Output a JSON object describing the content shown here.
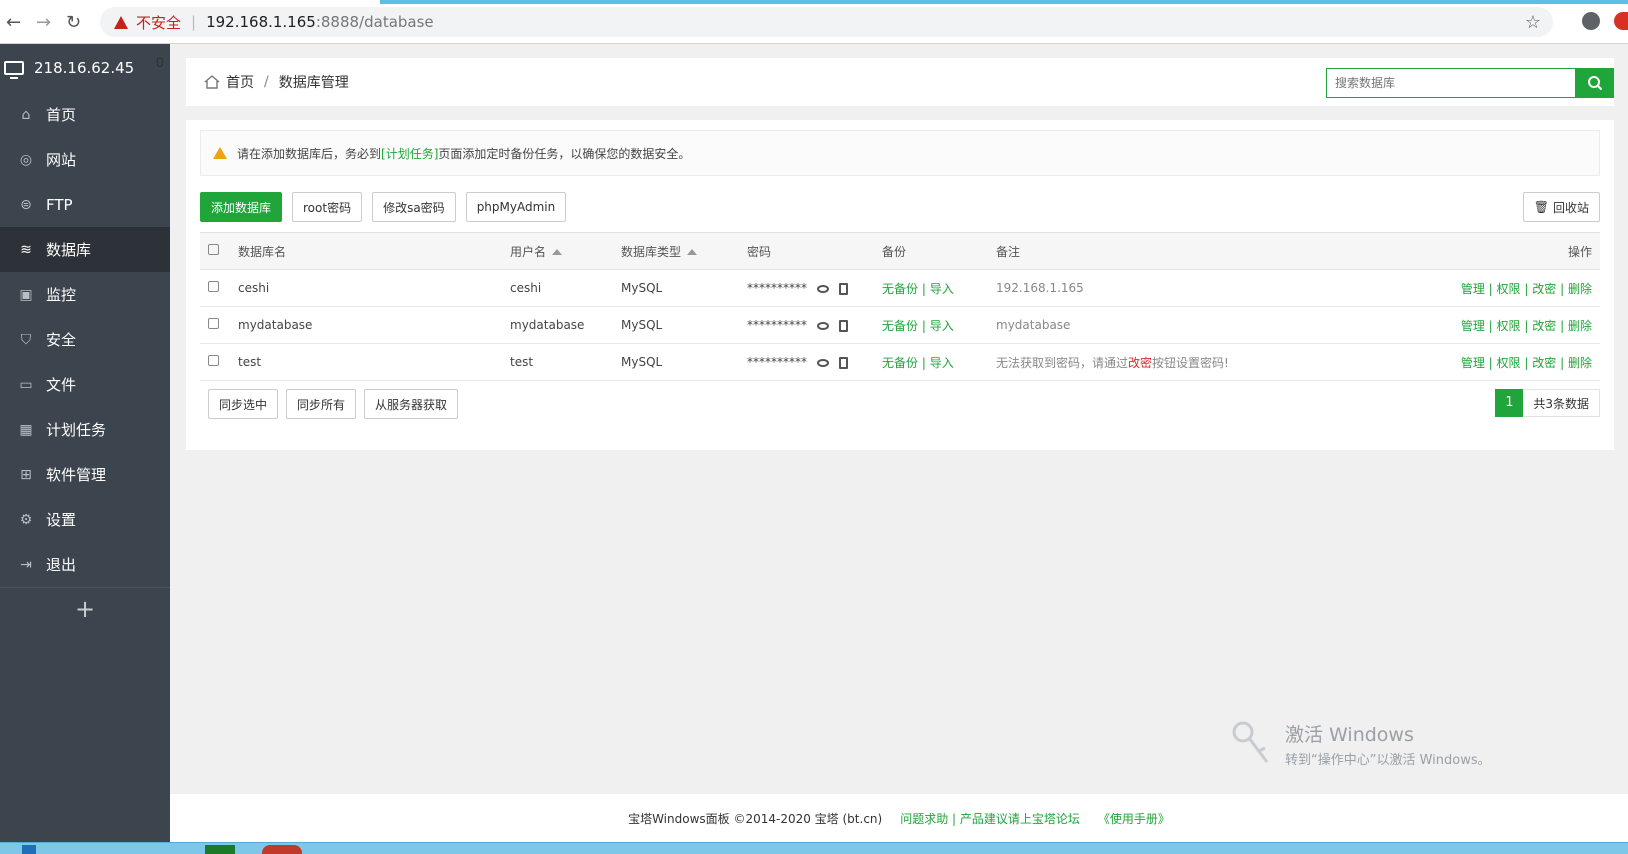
{
  "browser": {
    "insecure_label": "不安全",
    "url_host": "192.168.1.165",
    "url_path": ":8888/database"
  },
  "sidebar": {
    "server_ip": "218.16.62.45",
    "badge": "0",
    "items": [
      {
        "label": "首页",
        "icon": "home-icon"
      },
      {
        "label": "网站",
        "icon": "globe-icon"
      },
      {
        "label": "FTP",
        "icon": "ftp-icon"
      },
      {
        "label": "数据库",
        "icon": "database-icon"
      },
      {
        "label": "监控",
        "icon": "monitor-icon"
      },
      {
        "label": "安全",
        "icon": "shield-icon"
      },
      {
        "label": "文件",
        "icon": "folder-icon"
      },
      {
        "label": "计划任务",
        "icon": "calendar-icon"
      },
      {
        "label": "软件管理",
        "icon": "grid-icon"
      },
      {
        "label": "设置",
        "icon": "gear-icon"
      },
      {
        "label": "退出",
        "icon": "logout-icon"
      }
    ],
    "add_label": "+"
  },
  "breadcrumb": {
    "home": "首页",
    "sep": "/",
    "current": "数据库管理"
  },
  "search": {
    "placeholder": "搜索数据库"
  },
  "notice": {
    "prefix": "请在添加数据库后，务必到",
    "link": "[计划任务]",
    "suffix": "页面添加定时备份任务，以确保您的数据安全。"
  },
  "toolbar": {
    "add_db": "添加数据库",
    "root_pwd": "root密码",
    "sa_pwd": "修改sa密码",
    "phpmyadmin": "phpMyAdmin",
    "recycle": "回收站"
  },
  "table": {
    "headers": {
      "name": "数据库名",
      "user": "用户名",
      "type": "数据库类型",
      "password": "密码",
      "backup": "备份",
      "remark": "备注",
      "ops": "操作"
    },
    "rows": [
      {
        "name": "ceshi",
        "user": "ceshi",
        "type": "MySQL",
        "password": "**********",
        "backup": "无备份",
        "import": "导入",
        "remark": "192.168.1.165"
      },
      {
        "name": "mydatabase",
        "user": "mydatabase",
        "type": "MySQL",
        "password": "**********",
        "backup": "无备份",
        "import": "导入",
        "remark": "mydatabase"
      },
      {
        "name": "test",
        "user": "test",
        "type": "MySQL",
        "password": "**********",
        "backup": "无备份",
        "import": "导入",
        "remark_prefix": "无法获取到密码，请通过",
        "remark_link": "改密",
        "remark_suffix": "按钮设置密码!"
      }
    ],
    "ops": {
      "manage": "管理",
      "perm": "权限",
      "chpwd": "改密",
      "delete": "删除",
      "sep": "|"
    }
  },
  "bottom": {
    "sync_selected": "同步选中",
    "sync_all": "同步所有",
    "from_server": "从服务器获取",
    "page": "1",
    "total": "共3条数据"
  },
  "footer": {
    "copyright": "宝塔Windows面板 ©2014-2020 宝塔 (bt.cn)",
    "help": "问题求助 | 产品建议请上宝塔论坛",
    "manual": "《使用手册》"
  },
  "watermark": {
    "line1": "激活 Windows",
    "line2": "转到“操作中心”以激活 Windows。"
  },
  "colors": {
    "accent": "#20a53a",
    "sidebar": "#3c444d",
    "sidebar_active": "#2c3238",
    "warning": "#ef7d22"
  }
}
